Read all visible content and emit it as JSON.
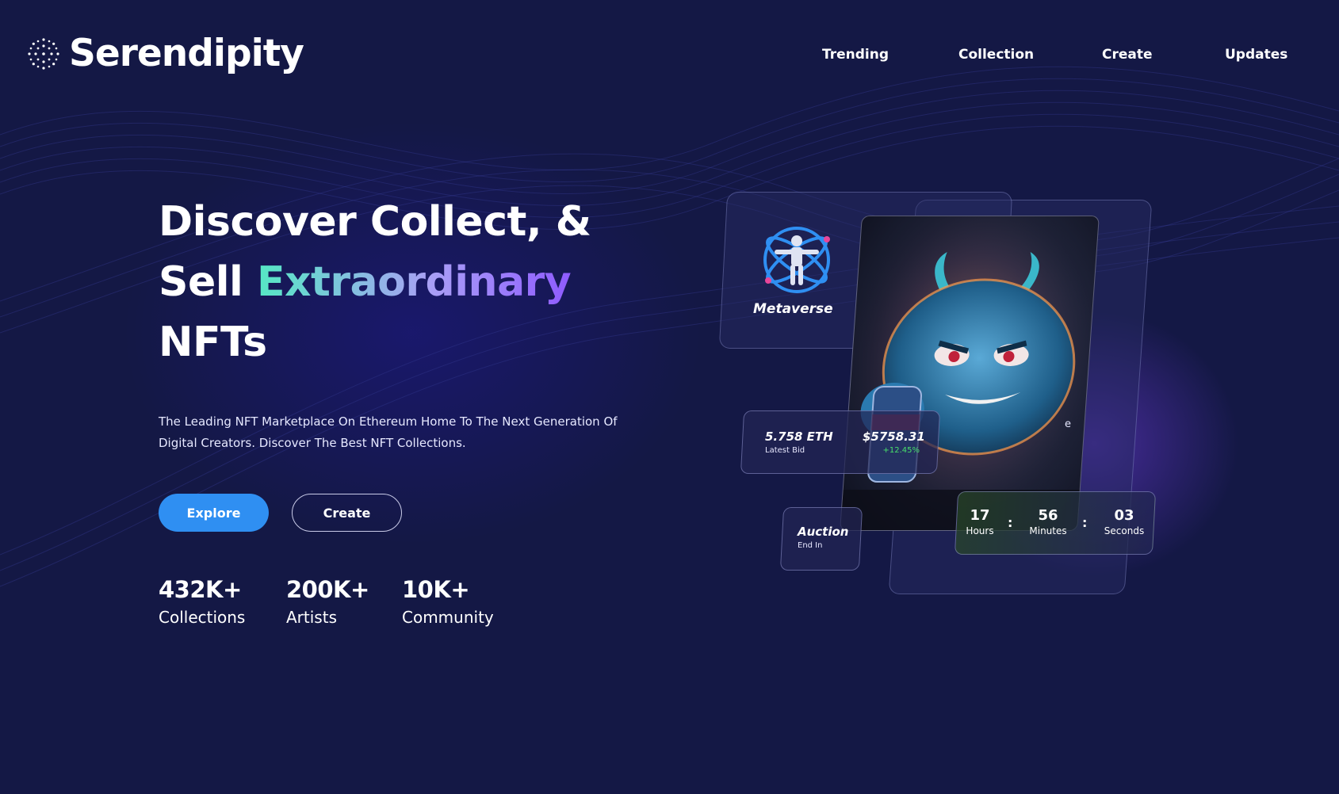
{
  "brand": {
    "name": "Serendipity",
    "logo_icon": "dotted-circle-logo-icon"
  },
  "nav": [
    {
      "label": "Trending"
    },
    {
      "label": "Collection"
    },
    {
      "label": "Create"
    },
    {
      "label": "Updates"
    }
  ],
  "hero": {
    "headline_line1": "Discover Collect, &",
    "headline_line2_start": "Sell ",
    "headline_line2_highlight": "Extraordinary",
    "headline_line3": "NFTs",
    "description": "The Leading NFT Marketplace On Ethereum Home To The Next Generation Of Digital Creators. Discover The Best NFT Collections.",
    "buttons": {
      "explore": "Explore",
      "create": "Create"
    },
    "highlight_gradient": [
      "#55e8c4",
      "#a9a0f5",
      "#8e5bff"
    ]
  },
  "stats": [
    {
      "value": "432K+",
      "label": "Collections"
    },
    {
      "value": "200K+",
      "label": "Artists"
    },
    {
      "value": "10K+",
      "label": "Community"
    }
  ],
  "showcase": {
    "category": {
      "label": "Metaverse",
      "icon": "vitruvian-atom-icon"
    },
    "artwork": {
      "icon": "blue-monster-nft-artwork"
    },
    "bid": {
      "eth": "5.758 ETH",
      "eth_caption": "Latest Bid",
      "usd": "$5758.31",
      "change": "+12.45%"
    },
    "auction": {
      "title": "Auction",
      "subtitle": "End In"
    },
    "timer": {
      "hours": "17",
      "hours_label": "Hours",
      "minutes": "56",
      "minutes_label": "Minutes",
      "seconds": "03",
      "seconds_label": "Seconds",
      "separator": ":"
    },
    "hidden_text": "e"
  },
  "colors": {
    "background": "#141845",
    "primary_button": "#2f8ff2",
    "positive_change": "#48e06a"
  }
}
